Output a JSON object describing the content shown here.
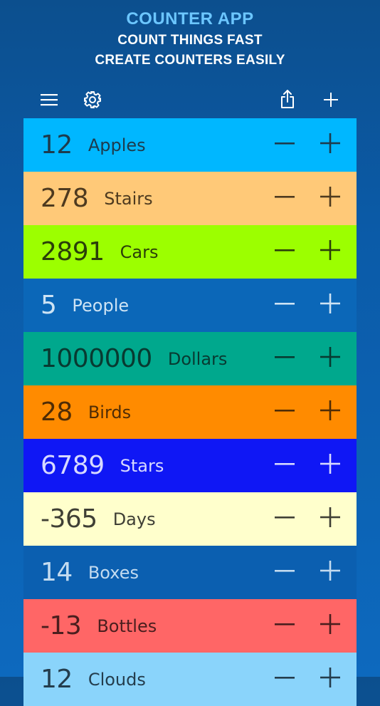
{
  "header": {
    "title": "COUNTER APP",
    "tagline_1": "COUNT THINGS FAST",
    "tagline_2": "CREATE COUNTERS EASILY"
  },
  "toolbar": {
    "menu_icon": "menu-icon",
    "settings_icon": "gear-icon",
    "share_icon": "share-icon",
    "add_icon": "plus-icon"
  },
  "counters": [
    {
      "count": "12",
      "label": "Apples",
      "bg": "#00b7ff",
      "fg": "#1d3b4d"
    },
    {
      "count": "278",
      "label": "Stairs",
      "bg": "#ffc978",
      "fg": "#4e3a1f"
    },
    {
      "count": "2891",
      "label": "Cars",
      "bg": "#9cff00",
      "fg": "#2a3f09"
    },
    {
      "count": "5",
      "label": "People",
      "bg": "#0b67b8",
      "fg": "#cde3f4"
    },
    {
      "count": "1000000",
      "label": "Dollars",
      "bg": "#00a88d",
      "fg": "#083a31"
    },
    {
      "count": "28",
      "label": "Birds",
      "bg": "#ff8b00",
      "fg": "#4f2c05"
    },
    {
      "count": "6789",
      "label": "Stars",
      "bg": "#0f17f5",
      "fg": "#d7d9ff"
    },
    {
      "count": "-365",
      "label": "Days",
      "bg": "#ffffcc",
      "fg": "#3f3f35"
    },
    {
      "count": "14",
      "label": "Boxes",
      "bg": "#0b5fb0",
      "fg": "#c3dbf0"
    },
    {
      "count": "-13",
      "label": "Bottles",
      "bg": "#ff6666",
      "fg": "#4a1e1e"
    },
    {
      "count": "12",
      "label": "Clouds",
      "bg": "#8ad4fb",
      "fg": "#243d4d"
    }
  ]
}
